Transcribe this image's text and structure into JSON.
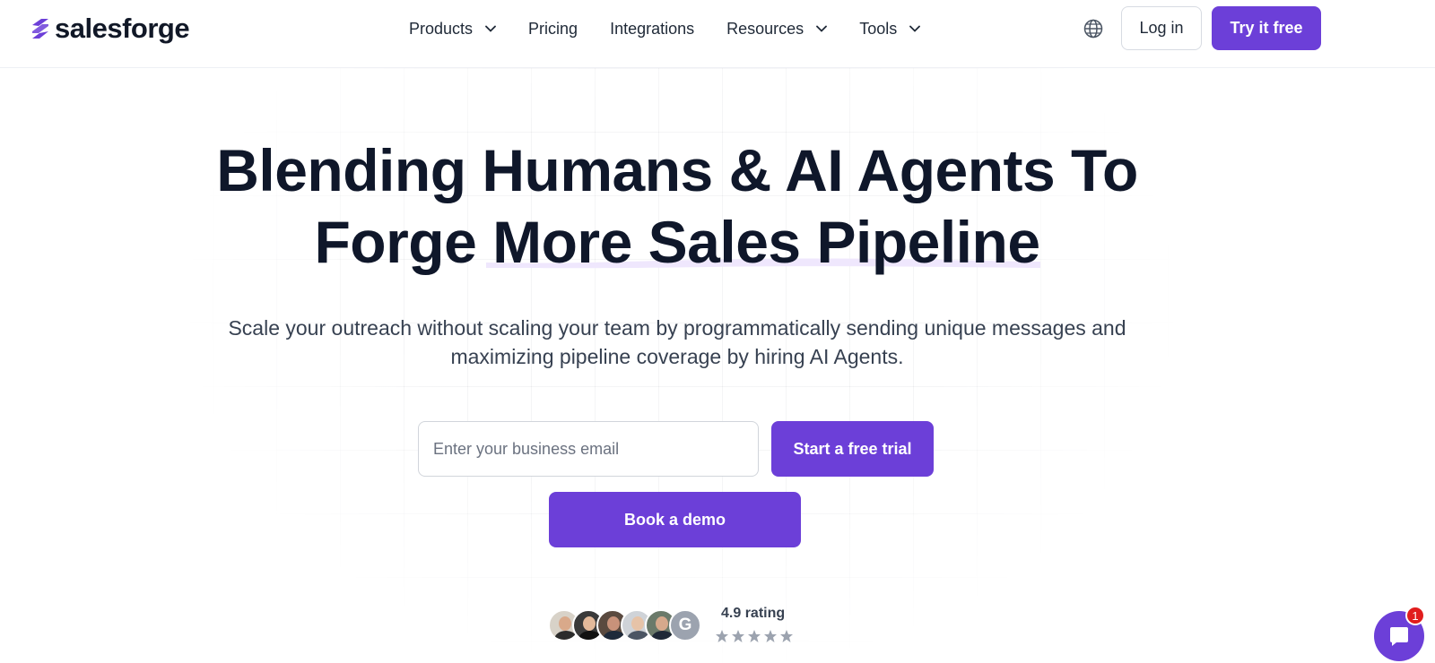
{
  "header": {
    "logo_text": "salesforge",
    "nav": [
      {
        "label": "Products",
        "has_dropdown": true
      },
      {
        "label": "Pricing",
        "has_dropdown": false
      },
      {
        "label": "Integrations",
        "has_dropdown": false
      },
      {
        "label": "Resources",
        "has_dropdown": true
      },
      {
        "label": "Tools",
        "has_dropdown": true
      }
    ],
    "language_icon": "globe-icon",
    "login_label": "Log in",
    "try_label": "Try it free"
  },
  "hero": {
    "title_line1": "Blending Humans & AI Agents To",
    "title_line2": "Forge More Sales Pipeline",
    "subtitle_line1": "Scale your outreach without scaling your team by programmatically sending unique messages and",
    "subtitle_line2": "maximizing pipeline coverage by hiring AI Agents.",
    "email_placeholder": "Enter your business email",
    "email_value": "",
    "trial_label": "Start a free trial",
    "demo_label": "Book a demo"
  },
  "rating": {
    "text": "4.9 rating",
    "stars": 5,
    "badge_letter": "G",
    "avatar_count": 5
  },
  "chat": {
    "icon": "chat-bubble-icon",
    "notification_count": "1"
  },
  "colors": {
    "brand": "#6c3fd8",
    "heading": "#0f172a",
    "body": "#374151",
    "star": "#9ca3af",
    "badge_red": "#e11d1d"
  }
}
